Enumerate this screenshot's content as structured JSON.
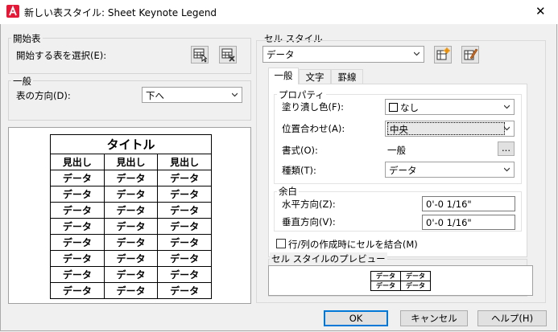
{
  "window": {
    "title": "新しい表スタイル: Sheet Keynote Legend"
  },
  "starting_table": {
    "group_label": "開始表",
    "select_label": "開始する表を選択(E):"
  },
  "general": {
    "group_label": "一般",
    "direction_label": "表の方向(D):",
    "direction_value": "下へ"
  },
  "preview_table": {
    "title": "タイトル",
    "headers": [
      "見出し",
      "見出し",
      "見出し"
    ],
    "cell": "データ",
    "data_rows": 8
  },
  "cell_style": {
    "group_label": "セル スタイル",
    "selected": "データ",
    "tabs": [
      "一般",
      "文字",
      "罫線"
    ],
    "properties": {
      "label": "プロパティ",
      "fill_label": "塗り潰し色(F):",
      "fill_value": "なし",
      "align_label": "位置合わせ(A):",
      "align_value": "中央",
      "format_label": "書式(O):",
      "format_value": "一般",
      "format_button": "...",
      "type_label": "種類(T):",
      "type_value": "データ"
    },
    "margins": {
      "label": "余白",
      "horizontal_label": "水平方向(Z):",
      "horizontal_value": "0'-0 1/16\"",
      "vertical_label": "垂直方向(V):",
      "vertical_value": "0'-0 1/16\""
    },
    "merge_label": "行/列の作成時にセルを結合(M)",
    "preview_label": "セル スタイルのプレビュー",
    "preview_cell": "データ"
  },
  "buttons": {
    "ok": "OK",
    "cancel": "キャンセル",
    "help": "ヘルプ(H)"
  }
}
